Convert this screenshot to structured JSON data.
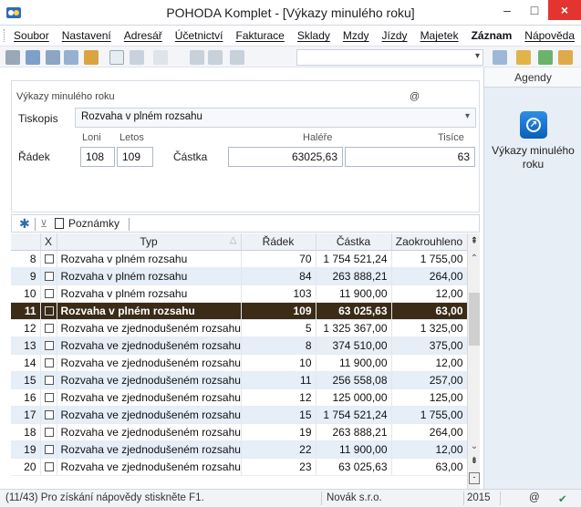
{
  "window": {
    "title": "POHODA Komplet - [Výkazy minulého roku]",
    "min": "–",
    "max": "□",
    "close": "×"
  },
  "menu": [
    "Soubor",
    "Nastavení",
    "Adresář",
    "Účetnictví",
    "Fakturace",
    "Sklady",
    "Mzdy",
    "Jízdy",
    "Majetek",
    "Záznam",
    "Nápověda"
  ],
  "form": {
    "title": "Výkazy minulého roku",
    "at_icon": "@",
    "tiskopis_label": "Tiskopis",
    "tiskopis_value": "Rozvaha v plném rozsahu",
    "radek_label": "Řádek",
    "loni_label": "Loni",
    "letos_label": "Letos",
    "loni_value": "108",
    "letos_value": "109",
    "castka_label": "Částka",
    "halere_label": "Haléře",
    "tisice_label": "Tisíce",
    "halere_value": "63025,63",
    "tisice_value": "63"
  },
  "agenda": {
    "header": "Agendy",
    "item_label_1": "Výkazy minulého",
    "item_label_2": "roku"
  },
  "tabs": {
    "star": "✱",
    "notes": "Poznámky"
  },
  "table": {
    "headers": [
      "",
      "X",
      "Typ",
      "Řádek",
      "Částka",
      "Zaokrouhleno"
    ],
    "rows": [
      {
        "n": "8",
        "typ": "Rozvaha v plném rozsahu",
        "radek": "70",
        "castka": "1 754 521,24",
        "zaok": "1 755,00"
      },
      {
        "n": "9",
        "typ": "Rozvaha v plném rozsahu",
        "radek": "84",
        "castka": "263 888,21",
        "zaok": "264,00"
      },
      {
        "n": "10",
        "typ": "Rozvaha v plném rozsahu",
        "radek": "103",
        "castka": "11 900,00",
        "zaok": "12,00"
      },
      {
        "n": "11",
        "typ": "Rozvaha v plném rozsahu",
        "radek": "109",
        "castka": "63 025,63",
        "zaok": "63,00"
      },
      {
        "n": "12",
        "typ": "Rozvaha ve zjednodušeném rozsahu",
        "radek": "5",
        "castka": "1 325 367,00",
        "zaok": "1 325,00"
      },
      {
        "n": "13",
        "typ": "Rozvaha ve zjednodušeném rozsahu",
        "radek": "8",
        "castka": "374 510,00",
        "zaok": "375,00"
      },
      {
        "n": "14",
        "typ": "Rozvaha ve zjednodušeném rozsahu",
        "radek": "10",
        "castka": "11 900,00",
        "zaok": "12,00"
      },
      {
        "n": "15",
        "typ": "Rozvaha ve zjednodušeném rozsahu",
        "radek": "11",
        "castka": "256 558,08",
        "zaok": "257,00"
      },
      {
        "n": "16",
        "typ": "Rozvaha ve zjednodušeném rozsahu",
        "radek": "12",
        "castka": "125 000,00",
        "zaok": "125,00"
      },
      {
        "n": "17",
        "typ": "Rozvaha ve zjednodušeném rozsahu",
        "radek": "15",
        "castka": "1 754 521,24",
        "zaok": "1 755,00"
      },
      {
        "n": "18",
        "typ": "Rozvaha ve zjednodušeném rozsahu",
        "radek": "19",
        "castka": "263 888,21",
        "zaok": "264,00"
      },
      {
        "n": "19",
        "typ": "Rozvaha ve zjednodušeném rozsahu",
        "radek": "22",
        "castka": "11 900,00",
        "zaok": "12,00"
      },
      {
        "n": "20",
        "typ": "Rozvaha ve zjednodušeném rozsahu",
        "radek": "23",
        "castka": "63 025,63",
        "zaok": "63,00"
      }
    ]
  },
  "status": {
    "hint": "(11/43) Pro získání nápovědy stiskněte F1.",
    "company": "Novák s.r.o.",
    "year": "2015",
    "at": "@",
    "ok": "✔"
  }
}
